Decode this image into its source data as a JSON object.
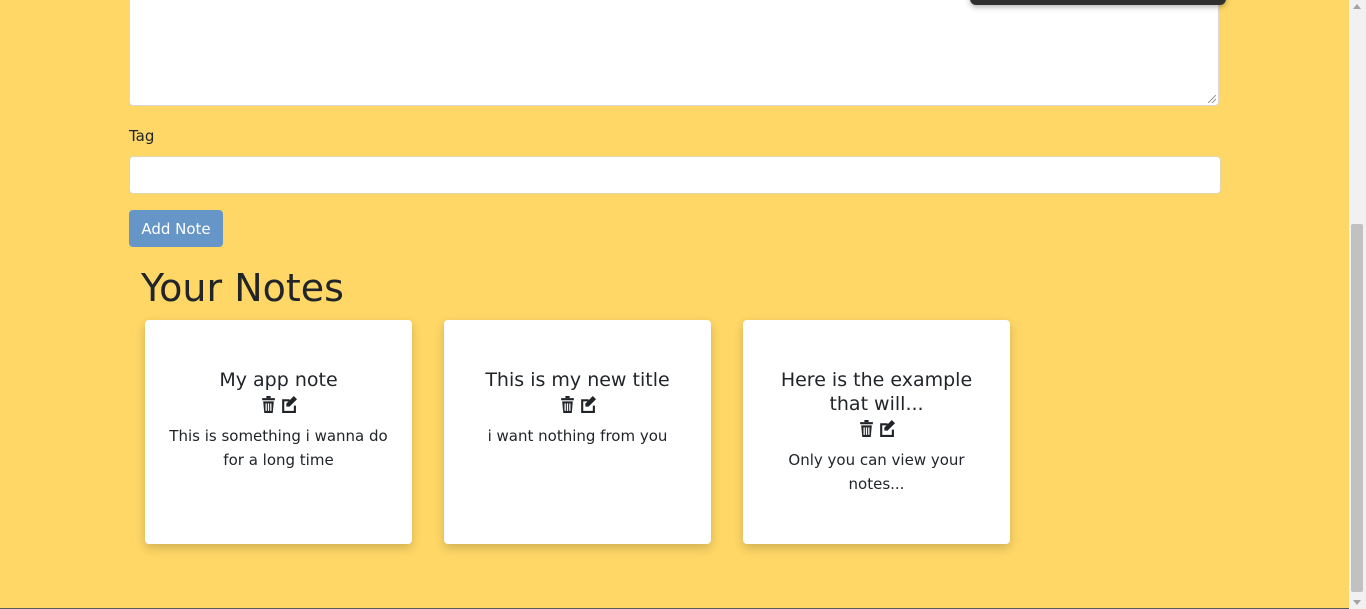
{
  "form": {
    "tag_label": "Tag",
    "tag_value": "",
    "add_button_label": "Add Note"
  },
  "notes_section": {
    "title": "Your Notes"
  },
  "notes": [
    {
      "title": "My app note",
      "description": "This is something i wanna do for a long time"
    },
    {
      "title": "This is my new title",
      "description": "i want nothing from you"
    },
    {
      "title": "Here is the example that will...",
      "description": "Only you can view your notes..."
    }
  ],
  "icons": {
    "delete": "trash-icon",
    "edit": "edit-icon"
  },
  "colors": {
    "background": "#fed766",
    "button": "#6696c8"
  }
}
